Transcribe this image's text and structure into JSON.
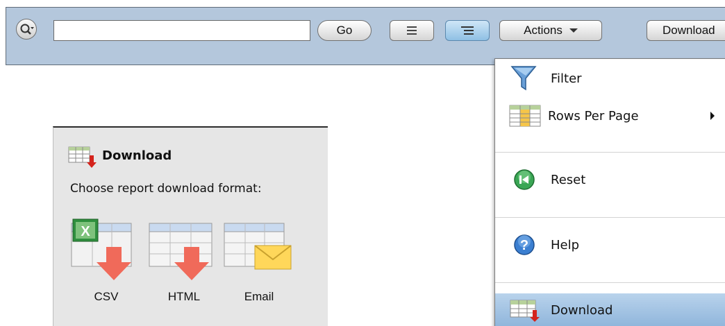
{
  "toolbar": {
    "search_value": "",
    "go_label": "Go",
    "actions_label": "Actions",
    "download_label": "Download"
  },
  "actions_menu": {
    "items": [
      {
        "label": "Filter",
        "icon": "funnel-icon"
      },
      {
        "label": "Rows Per Page",
        "icon": "table-grid-icon",
        "has_submenu": true
      },
      {
        "label": "Reset",
        "icon": "reset-icon"
      },
      {
        "label": "Help",
        "icon": "help-icon"
      },
      {
        "label": "Download",
        "icon": "table-download-icon",
        "highlighted": true
      }
    ]
  },
  "download_panel": {
    "title": "Download",
    "prompt": "Choose report download format:",
    "formats": [
      {
        "label": "CSV",
        "icon": "excel-table-download-icon"
      },
      {
        "label": "HTML",
        "icon": "table-download-icon"
      },
      {
        "label": "Email",
        "icon": "table-email-icon"
      }
    ]
  },
  "colors": {
    "toolbar_bg": "#b4c7dc",
    "menu_highlight": "#9fc0e1",
    "download_arrow": "#e8403a",
    "panel_bg": "#e6e6e6"
  }
}
